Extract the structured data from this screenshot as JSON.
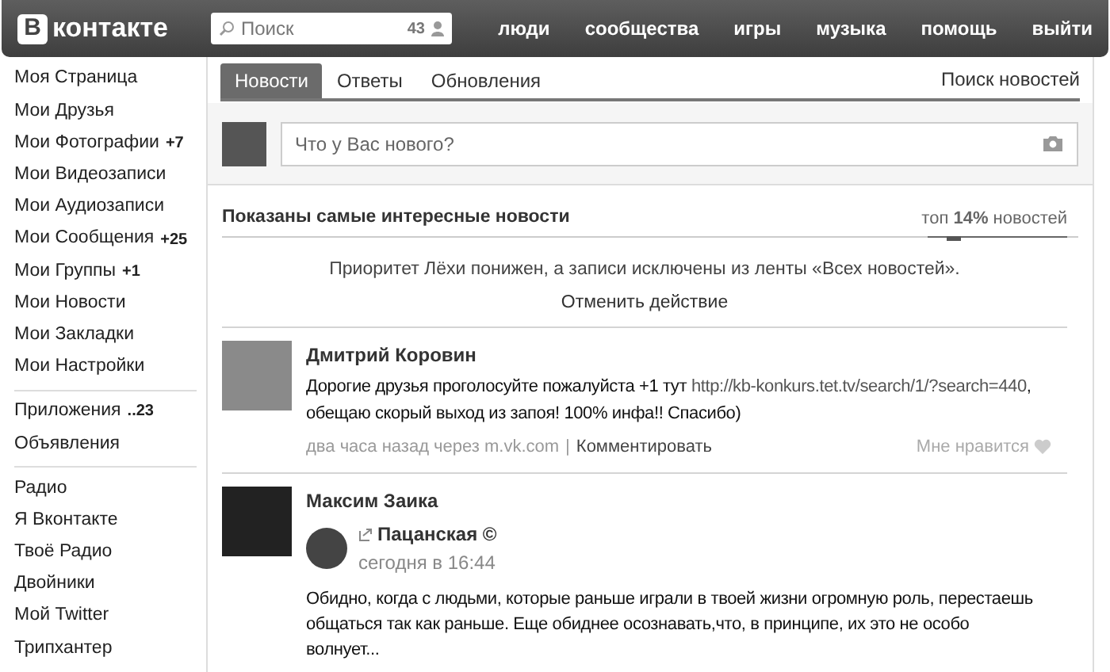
{
  "header": {
    "logo_badge": "В",
    "logo_text": "контакте",
    "search": {
      "placeholder": "Поиск",
      "count": "43"
    },
    "nav": [
      "люди",
      "сообщества",
      "игры",
      "музыка",
      "помощь",
      "выйти"
    ]
  },
  "sidebar": {
    "groups": [
      [
        {
          "label": "Моя Страница"
        },
        {
          "label": "Мои Друзья"
        },
        {
          "label": "Мои Фотографии",
          "badge": "+7"
        },
        {
          "label": "Мои Видеозаписи"
        },
        {
          "label": "Мои Аудиозаписи"
        },
        {
          "label": "Мои Сообщения",
          "badge": "+25"
        },
        {
          "label": "Мои Группы",
          "badge": "+1"
        },
        {
          "label": "Мои Новости"
        },
        {
          "label": "Мои Закладки"
        },
        {
          "label": "Мои Настройки"
        }
      ],
      [
        {
          "label": "Приложения",
          "badge": "..23"
        },
        {
          "label": "Объявления"
        }
      ],
      [
        {
          "label": "Радио"
        },
        {
          "label": "Я Вконтакте"
        },
        {
          "label": "Твоё Радио"
        },
        {
          "label": "Двойники"
        },
        {
          "label": "Мой Twitter"
        },
        {
          "label": "Трипхантер"
        }
      ]
    ]
  },
  "tabs": [
    {
      "label": "Новости",
      "selected": true
    },
    {
      "label": "Ответы",
      "selected": false
    },
    {
      "label": "Обновления",
      "selected": false
    }
  ],
  "search_news": "Поиск новостей",
  "composer": {
    "placeholder": "Что у Вас нового?"
  },
  "feed_header": {
    "title": "Показаны самые интересные новости",
    "filter": "топ **14%** новостей",
    "level": 0.14
  },
  "notice": {
    "text": "Приоритет Лёхи понижен, а записи исключены из ленты «Всех новостей».",
    "undo": "Отменить действие"
  },
  "posts": [
    {
      "kind": "text",
      "author": "Дмитрий Коровин",
      "text_before": "Дорогие друзья проголосуйте пожалуйста +1 тут",
      "link": "http://kb-konkurs.tet.tv/search/1/?search=440",
      "text_after": ", обещаю скорый выход из запоя! 100% инфа!! Спасибо)",
      "time": "два часа назад через m.vk.com",
      "separator": "|",
      "comment": "Комментировать",
      "like": "Мне нравится"
    },
    {
      "kind": "repost",
      "author": "Максим Заика",
      "source": "Пацанская ©",
      "time": "сегодня в 16:44",
      "text": "Обидно, когда с людьми, которые раньше играли в твоей жизни огромную роль, перестаешь общаться так как раньше. Еще обиднее осознавать,что, в принципе, их это не особо волнует..."
    }
  ]
}
